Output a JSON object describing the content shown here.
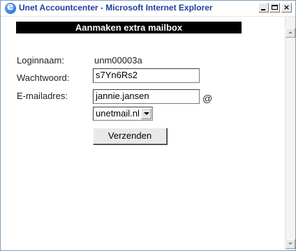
{
  "window": {
    "title": "Unet Accountcenter - Microsoft Internet Explorer"
  },
  "form": {
    "header": "Aanmaken extra mailbox",
    "login_label": "Loginnaam:",
    "login_value": "unm00003a",
    "password_label": "Wachtwoord:",
    "password_value": "s7Yn6Rs2",
    "email_label": "E-mailadres:",
    "email_value": "jannie.jansen",
    "at_sign": "@",
    "domain_selected": "unetmail.nl",
    "submit_label": "Verzenden"
  },
  "colors": {
    "header_bg": "#000000",
    "header_text": "#ffffff",
    "title_text": "#1a3f9a"
  },
  "icons": {
    "app": "internet-explorer-icon",
    "minimize": "minimize-icon",
    "maximize": "maximize-icon",
    "close": "close-icon",
    "scroll_up": "scroll-up-icon",
    "scroll_down": "scroll-down-icon",
    "dropdown": "chevron-down-icon"
  }
}
